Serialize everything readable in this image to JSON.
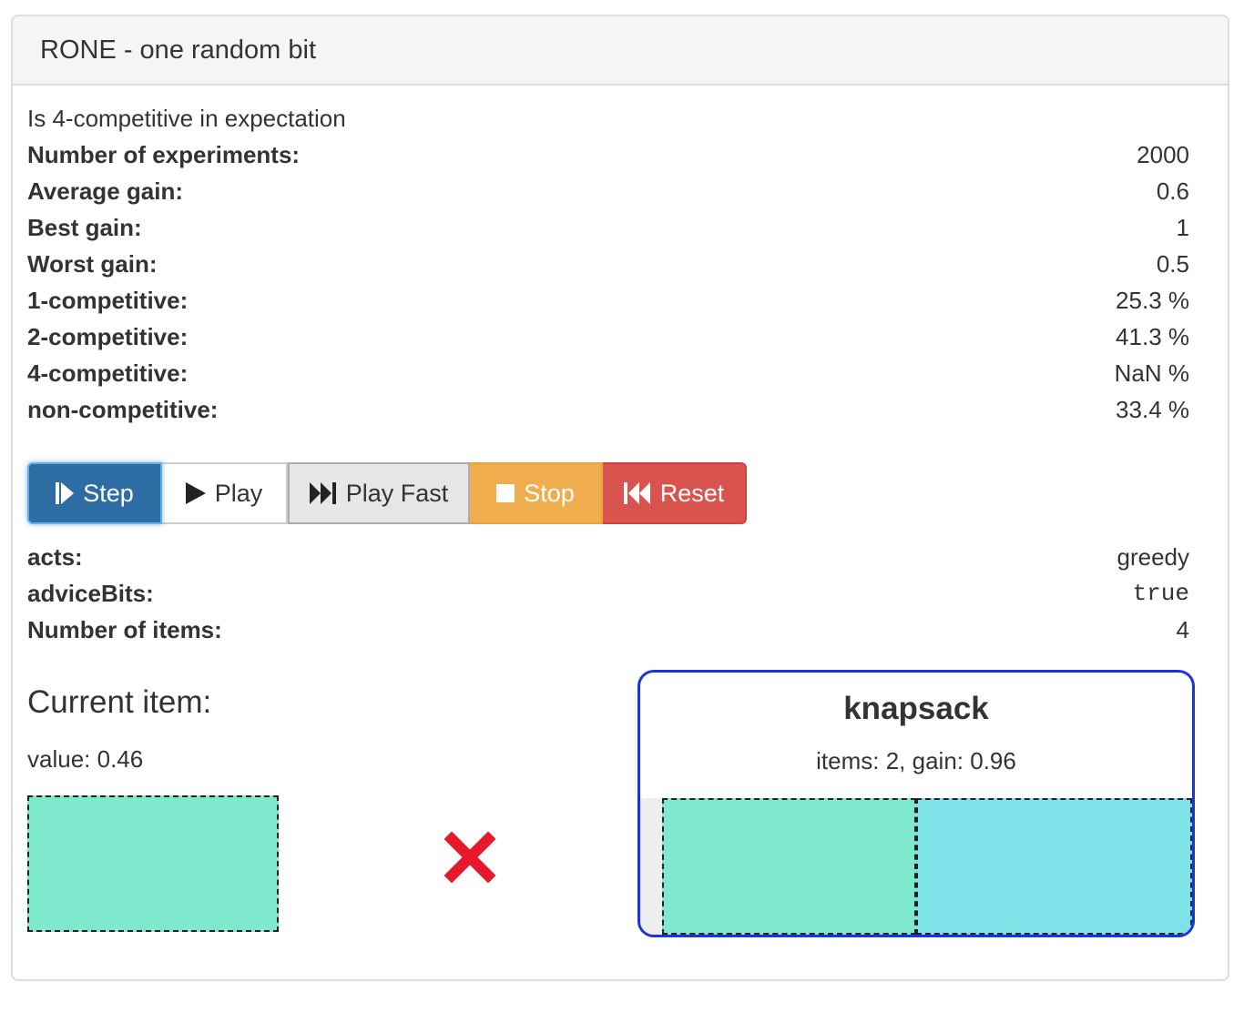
{
  "panel": {
    "title": "RONE - one random bit"
  },
  "description": "Is 4-competitive in expectation",
  "stats": [
    {
      "label": "Number of experiments:",
      "value": "2000"
    },
    {
      "label": "Average gain:",
      "value": "0.6"
    },
    {
      "label": "Best gain:",
      "value": "1"
    },
    {
      "label": "Worst gain:",
      "value": "0.5"
    },
    {
      "label": "1-competitive:",
      "value": "25.3 %"
    },
    {
      "label": "2-competitive:",
      "value": "41.3 %"
    },
    {
      "label": "4-competitive:",
      "value": "NaN %"
    },
    {
      "label": "non-competitive:",
      "value": "33.4 %"
    }
  ],
  "controls": {
    "step": "Step",
    "play": "Play",
    "play_fast": "Play Fast",
    "stop": "Stop",
    "reset": "Reset"
  },
  "params": [
    {
      "label": "acts:",
      "value": "greedy"
    },
    {
      "label": "adviceBits:",
      "value": "true"
    },
    {
      "label": "Number of items:",
      "value": "4"
    }
  ],
  "current_item": {
    "title": "Current item:",
    "value_text": "value: 0.46",
    "color": "#7de8cc"
  },
  "reject_icon": "cross-icon",
  "knapsack": {
    "title": "knapsack",
    "info": "items: 2, gain: 0.96",
    "border_color": "#1a35e0",
    "items": [
      {
        "value": 0.46,
        "color": "#7de8cc"
      },
      {
        "value": 0.5,
        "color": "#7de3e8"
      }
    ]
  },
  "colors": {
    "step": "#2e6da4",
    "stop": "#f0ad4e",
    "reset": "#d9534f",
    "reject": "#e8192c"
  }
}
